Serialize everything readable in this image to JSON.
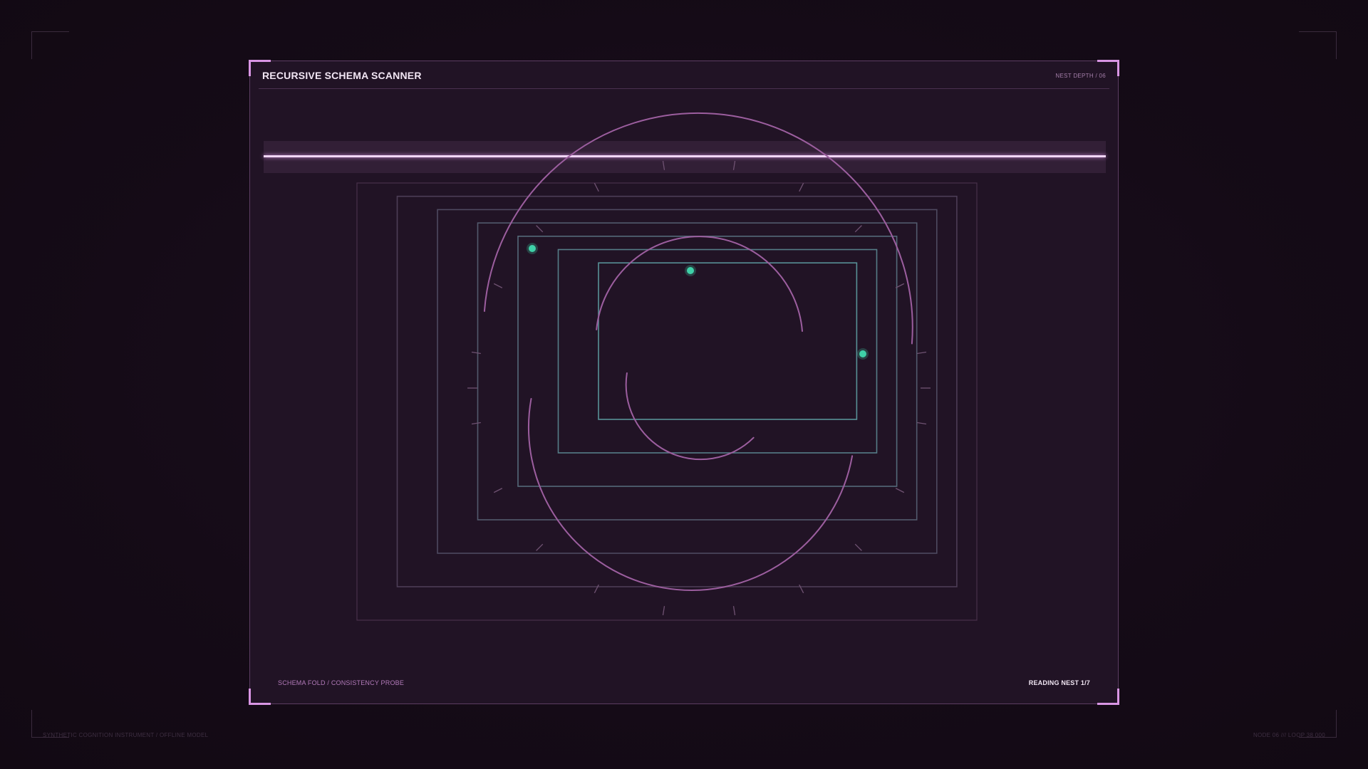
{
  "panel": {
    "title": "RECURSIVE SCHEMA SCANNER",
    "nest_depth": "NEST DEPTH / 06",
    "probe_label": "SCHEMA FOLD / CONSISTENCY PROBE",
    "reading_label": "READING NEST 1/7"
  },
  "footer": {
    "left": "SYNTHETIC COGNITION INSTRUMENT / OFFLINE MODEL",
    "right": "NODE 06 /// LOOP 38 000"
  },
  "scanner": {
    "nest_count": 7,
    "current_nest": 1,
    "scan_progress": 1.0
  },
  "colors": {
    "background": "#140a16",
    "panel": "#211325",
    "accent": "#d995e4",
    "node": "#3fd1a8",
    "frame_outer": "#6b4a6c",
    "frame_inner": "#5d9ea3"
  }
}
